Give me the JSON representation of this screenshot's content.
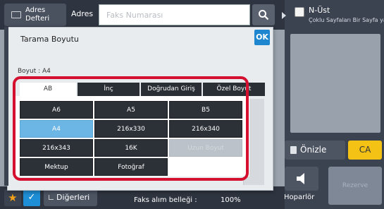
{
  "header": {
    "address_book": "Adres Defteri",
    "address": "Adres",
    "fax_placeholder": "Faks Numarası"
  },
  "right_panel": {
    "nup_title": "N-Üst",
    "nup_subtitle": "Çoklu Sayfaları Bir Sayfa yap",
    "preview": "Önizle",
    "ca": "CA",
    "speaker": "Hoparlör",
    "faded_button": "Rezerve"
  },
  "bottom": {
    "others": "Diğerleri",
    "memory_label": "Faks alım belleği :",
    "memory_value": "100%"
  },
  "dialog": {
    "title": "Tarama Boyutu",
    "ok": "OK",
    "size_label": "Boyut : A4",
    "tabs": [
      "AB",
      "İnç",
      "Doğrudan Giriş",
      "Özel Boyut"
    ],
    "active_tab": "AB",
    "sizes": [
      "A6",
      "A5",
      "B5",
      "A4",
      "216x330",
      "216x340",
      "216x343",
      "16K",
      "Uzun Boyut",
      "Mektup",
      "Fotoğraf"
    ],
    "selected_size": "A4",
    "disabled_size": "Uzun Boyut"
  },
  "colors": {
    "accent": "#1d86cf",
    "selected": "#6cb6e6",
    "highlight": "#d40f2f",
    "ca": "#f3c215"
  },
  "icons": [
    "address-book-icon",
    "search-icon",
    "expand-arrow-icon",
    "checkbox-icon",
    "preview-icon",
    "speaker-icon",
    "star-icon",
    "checkmark-icon"
  ]
}
